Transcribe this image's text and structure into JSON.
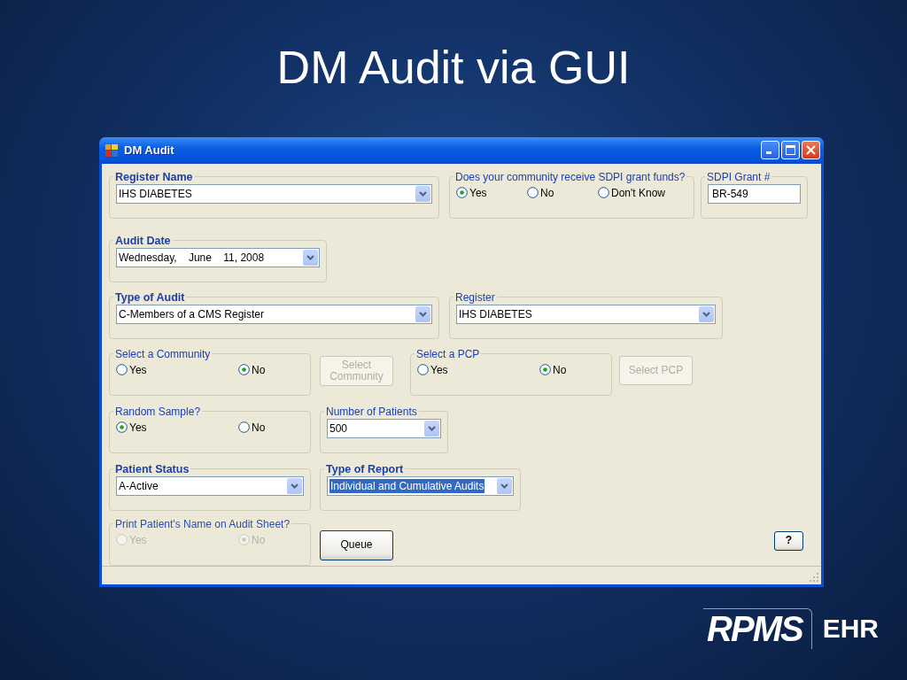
{
  "slide": {
    "title": "DM Audit via GUI",
    "logo": {
      "wordmark": "RPMS",
      "suffix": "EHR"
    }
  },
  "window": {
    "title": "DM Audit"
  },
  "rows": [
    {
      "items": [
        {
          "kind": "group",
          "label": "Register Name",
          "emphasized": true,
          "disabled": false,
          "control": {
            "kind": "combo",
            "value": "IHS DIABETES",
            "highlighted": false
          }
        },
        {
          "kind": "group",
          "label": "Does your community receive SDPI grant funds?",
          "emphasized": false,
          "disabled": false,
          "control": {
            "kind": "radios",
            "options": [
              {
                "label": "Yes",
                "selected": true
              },
              {
                "label": "No",
                "selected": false
              },
              {
                "label": "Don't Know",
                "selected": false
              }
            ]
          }
        },
        {
          "kind": "group",
          "label": "SDPI Grant #",
          "emphasized": false,
          "disabled": false,
          "control": {
            "kind": "text",
            "value": "BR-549"
          }
        }
      ]
    },
    {
      "items": [
        {
          "kind": "group",
          "label": "Audit Date",
          "emphasized": true,
          "disabled": false,
          "control": {
            "kind": "date",
            "value": "Wednesday,    June    11, 2008",
            "highlighted": false
          }
        }
      ]
    },
    {
      "items": [
        {
          "kind": "group",
          "label": "Type of Audit",
          "emphasized": true,
          "disabled": false,
          "control": {
            "kind": "combo",
            "value": "C-Members of a CMS Register",
            "highlighted": false
          }
        },
        {
          "kind": "group",
          "label": "Register",
          "emphasized": false,
          "disabled": false,
          "control": {
            "kind": "combo",
            "value": "IHS DIABETES",
            "highlighted": false
          }
        }
      ]
    },
    {
      "items": [
        {
          "kind": "group",
          "label": "Select a Community",
          "emphasized": false,
          "disabled": false,
          "control": {
            "kind": "radios",
            "options": [
              {
                "label": "Yes",
                "selected": false
              },
              {
                "label": "No",
                "selected": true
              }
            ]
          }
        },
        {
          "kind": "button",
          "label": "Select Community",
          "disabled": true
        },
        {
          "kind": "group",
          "label": "Select a PCP",
          "emphasized": false,
          "disabled": false,
          "control": {
            "kind": "radios",
            "options": [
              {
                "label": "Yes",
                "selected": false
              },
              {
                "label": "No",
                "selected": true
              }
            ]
          }
        },
        {
          "kind": "button",
          "label": "Select PCP",
          "disabled": true
        }
      ]
    },
    {
      "items": [
        {
          "kind": "group",
          "label": "Random Sample?",
          "emphasized": false,
          "disabled": false,
          "control": {
            "kind": "radios",
            "options": [
              {
                "label": "Yes",
                "selected": true
              },
              {
                "label": "No",
                "selected": false
              }
            ]
          }
        },
        {
          "kind": "group",
          "label": "Number of Patients",
          "emphasized": false,
          "disabled": false,
          "control": {
            "kind": "combo",
            "value": "500",
            "highlighted": false
          }
        }
      ]
    },
    {
      "items": [
        {
          "kind": "group",
          "label": "Patient Status",
          "emphasized": true,
          "disabled": false,
          "control": {
            "kind": "combo",
            "value": "A-Active",
            "highlighted": false
          }
        },
        {
          "kind": "group",
          "label": "Type of Report",
          "emphasized": true,
          "disabled": false,
          "control": {
            "kind": "combo",
            "value": "Individual and Cumulative Audits",
            "highlighted": true
          }
        }
      ]
    },
    {
      "items": [
        {
          "kind": "group",
          "label": "Print Patient's Name on Audit Sheet?",
          "emphasized": false,
          "disabled": true,
          "control": {
            "kind": "radios",
            "options": [
              {
                "label": "Yes",
                "selected": false
              },
              {
                "label": "No",
                "selected": true
              }
            ]
          }
        },
        {
          "kind": "button",
          "label": "Queue",
          "disabled": false
        },
        {
          "kind": "button",
          "label": "?",
          "disabled": false
        }
      ]
    }
  ]
}
